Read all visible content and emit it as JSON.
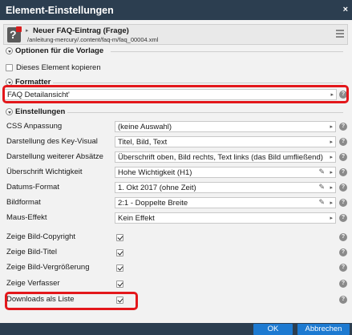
{
  "dialog": {
    "title": "Element-Einstellungen",
    "close_glyph": "×"
  },
  "resource": {
    "icon": "help-question-icon",
    "title": "Neuer FAQ-Eintrag (Frage)",
    "path": "/anleitung-mercury/.content/faq-m/faq_00004.xml"
  },
  "options": {
    "heading": "Optionen für die Vorlage",
    "copy_label": "Dieses Element kopieren",
    "copy_checked": false
  },
  "formatter": {
    "heading": "Formatter",
    "value": "FAQ Detailansicht'"
  },
  "settings": {
    "heading": "Einstellungen",
    "rows": [
      {
        "label": "CSS Anpassung",
        "type": "select",
        "value": "(keine Auswahl)"
      },
      {
        "label": "Darstellung des Key-Visual",
        "type": "select",
        "value": "Titel, Bild, Text"
      },
      {
        "label": "Darstellung weiterer Absätze",
        "type": "select",
        "value": "Überschrift oben, Bild rechts, Text links (das Bild umfließend)"
      },
      {
        "label": "Überschrift Wichtigkeit",
        "type": "select",
        "value": "Hohe Wichtigkeit (H1)",
        "editable": true
      },
      {
        "label": "Datums-Format",
        "type": "select",
        "value": "1. Okt 2017 (ohne Zeit)",
        "editable": true
      },
      {
        "label": "Bildformat",
        "type": "select",
        "value": "2:1 - Doppelte Breite",
        "editable": true
      },
      {
        "label": "Maus-Effekt",
        "type": "select",
        "value": "Kein Effekt"
      },
      {
        "label": "Zeige Bild-Copyright",
        "type": "checkbox",
        "checked": true
      },
      {
        "label": "Zeige Bild-Titel",
        "type": "checkbox",
        "checked": true
      },
      {
        "label": "Zeige Bild-Vergrößerung",
        "type": "checkbox",
        "checked": true
      },
      {
        "label": "Zeige Verfasser",
        "type": "checkbox",
        "checked": true
      },
      {
        "label": "Downloads als Liste",
        "type": "checkbox",
        "checked": true
      }
    ]
  },
  "buttons": {
    "ok": "OK",
    "cancel": "Abbrechen"
  },
  "icons": {
    "help": "help-circle-icon",
    "chevron": "chevron-right-icon",
    "pencil": "pencil-icon",
    "menu": "hamburger-menu-icon",
    "collapse": "collapse-toggle-icon"
  },
  "colors": {
    "titlebar": "#2c3e50",
    "button": "#1d7ad1",
    "highlight": "#e3171b",
    "background": "#f2f2f2"
  },
  "glyphs": {
    "help": "?",
    "chevron": "▸",
    "pencil": "✎",
    "question": "?"
  }
}
